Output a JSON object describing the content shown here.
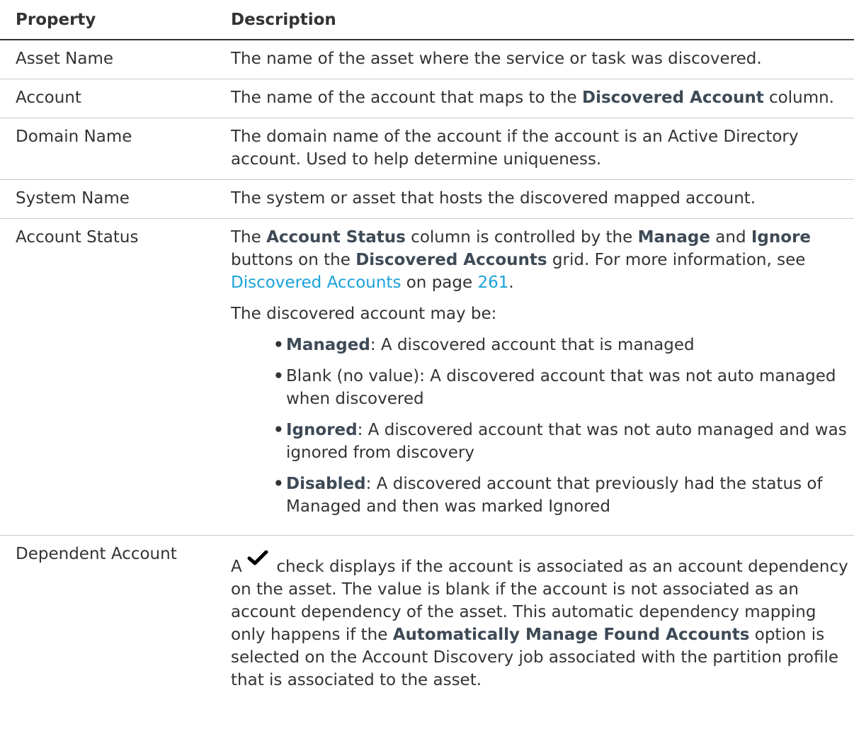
{
  "headers": {
    "property": "Property",
    "description": "Description"
  },
  "rows": {
    "asset_name": {
      "property": "Asset Name",
      "description": "The name of the asset where the service or task was discovered."
    },
    "account": {
      "property": "Account",
      "desc_a": "The name of the account that maps to the ",
      "desc_bold": "Discovered Account",
      "desc_b": " column."
    },
    "domain_name": {
      "property": "Domain Name",
      "description": "The domain name of the account if the account is an Active Directory account. Used to help determine uniqueness."
    },
    "system_name": {
      "property": "System Name",
      "description": "The system or asset that hosts the discovered mapped account."
    },
    "account_status": {
      "property": "Account Status",
      "t1": "The ",
      "b1": "Account Status",
      "t2": " column is controlled by the ",
      "b2": "Manage",
      "t3": " and ",
      "b3": "Ignore",
      "t4": " buttons on the ",
      "b4": "Discovered Accounts",
      "t5": " grid. For more information, see ",
      "link_text": "Discovered Accounts",
      "t6": " on page ",
      "page_link": "261",
      "t7": ".",
      "intro": "The discovered account may be:",
      "bullet_glyph": "•",
      "items": [
        {
          "bold": "Managed",
          "text": ": A discovered account that is managed"
        },
        {
          "bold": "",
          "text": "Blank (no value): A discovered account that was not auto managed when discovered"
        },
        {
          "bold": "Ignored",
          "text": ": A discovered account that was not auto managed and was ignored from discovery"
        },
        {
          "bold": "Disabled",
          "text": ": A discovered account that previously had the status of Managed and then was marked Ignored"
        }
      ]
    },
    "dependent_account": {
      "property": "Dependent Account",
      "t1": "A ",
      "check_icon": "checkmark-icon",
      "t2": " check displays if the account is associated as an account dependency on the asset. The value is blank if the account is not associated as an account dependency of the asset. This automatic dependency mapping only happens if the ",
      "b1": "Automatically Manage Found Accounts",
      "t3": " option is selected on the Account Discovery job associated with the partition profile that is associated to the asset."
    }
  }
}
